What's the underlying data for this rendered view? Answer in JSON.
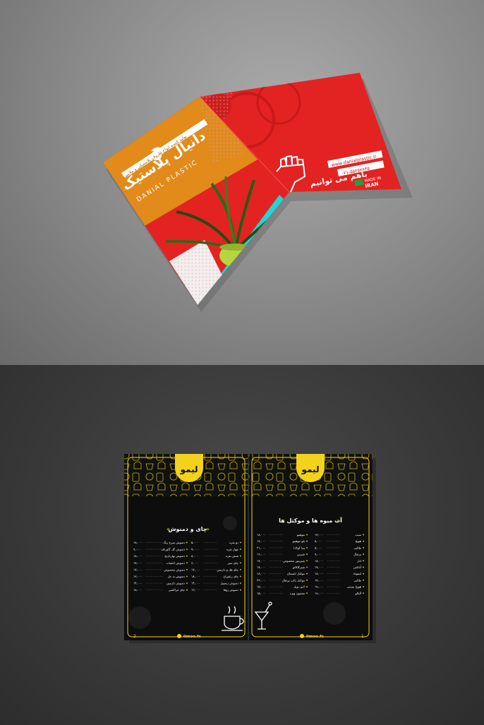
{
  "top_brochure": {
    "brand_name_fa": "دانیال پلاستیک",
    "brand_name_en": "DANIAL PLASTIC",
    "tagline_fa": "تولید کننده انواع ظروف پلاستیکی و ملامین",
    "slogan_fa": "باهم می توانیم",
    "contact_web": "www.danialplastic.ir",
    "contact_phone": "۰۲۱-۵۵۲۵۷۸۴۵",
    "made_in": "MADE IN",
    "country": "IRAN",
    "colors": {
      "orange": "#e28a1a",
      "red": "#e22424",
      "cyan": "#1fd6d6",
      "white": "#f2f2f2"
    }
  },
  "bottom_menu": {
    "logo": "لیمو",
    "left_page": {
      "section_title": "چای و دمنوش",
      "page_number": "2",
      "footer": "limoo.fc",
      "col_left_items": [
        {
          "name": "دمنوش سرخ رنگ",
          "price": "۱۸,۰۰۰"
        },
        {
          "name": "دمنوش گل گاوزبان",
          "price": "۹,۰۰۰"
        },
        {
          "name": "دمنوش بهارنارنج",
          "price": "۱۸,۰۰۰"
        },
        {
          "name": "دمنوش اعصاب",
          "price": "۱۷,۰۰۰"
        },
        {
          "name": "دمنوش مخصوص",
          "price": "۱۷,۰۰۰"
        },
        {
          "name": "دمنوش به حل",
          "price": "۱۳,۰۰۰"
        },
        {
          "name": "دمنوش دارچین",
          "price": "۱۴,۰۰۰"
        },
        {
          "name": "چای مراکشی",
          "price": "۱۸,۰۰۰"
        }
      ],
      "col_right_items": [
        {
          "name": "دو نفره",
          "price": "۵,۰۰۰"
        },
        {
          "name": "چهار نفره",
          "price": "۷,۰۰۰"
        },
        {
          "name": "شش نفره",
          "price": "۸,۰۰۰"
        },
        {
          "name": "چای سبز",
          "price": "۶,۰۰۰"
        },
        {
          "name": "چای هل و دارچین",
          "price": "۱۷,۰۰۰"
        },
        {
          "name": "چای زعفران",
          "price": "۱۸,۰۰۰"
        },
        {
          "name": "دمنوش زنجبیل",
          "price": "۱۴,۰۰۰"
        },
        {
          "name": "دمنوش زوفا",
          "price": "۱۳,۰۰۰"
        }
      ]
    },
    "right_page": {
      "section_title": "آب میوه ها و موکتل ها",
      "page_number": "1",
      "footer": "limoo.fc",
      "col_left_items": [
        {
          "name": "موهیتو",
          "price": "۱۸,۰۰۰"
        },
        {
          "name": "بلو موهیتو",
          "price": "۱۷,۰۰۰"
        },
        {
          "name": "پینا کولادا",
          "price": "۲۱,۰۰۰"
        },
        {
          "name": "شیرین",
          "price": "۱۹,۰۰۰"
        },
        {
          "name": "شیرموز مخصوص",
          "price": "۱۷,۰۰۰"
        },
        {
          "name": "شیرکاکائو",
          "price": "۱۷,۰۰۰"
        },
        {
          "name": "موکتل تابستان",
          "price": "۱۸,۰۰۰"
        },
        {
          "name": "موکتل پالپ پرتقال",
          "price": "۲۳,۰۰۰"
        },
        {
          "name": "لایم دوبل",
          "price": "۱۵,۰۰۰"
        },
        {
          "name": "معجون ویژه",
          "price": "۱۵,۰۰۰"
        }
      ],
      "col_right_items": [
        {
          "name": "سیب",
          "price": "۱۳,۰۰۰"
        },
        {
          "name": "هویج",
          "price": "۸,۰۰۰"
        },
        {
          "name": "طالبی",
          "price": "۸,۰۰۰"
        },
        {
          "name": "پرتقال",
          "price": "۹,۰۰۰"
        },
        {
          "name": "انار",
          "price": "۱۸,۰۰۰"
        },
        {
          "name": "آناناس",
          "price": "۱۷,۰۰۰"
        },
        {
          "name": "لیموناد",
          "price": "۱۸,۰۰۰"
        },
        {
          "name": "طالبی",
          "price": "۱۷,۰۰۰"
        },
        {
          "name": "هویج بستنی",
          "price": "۱۹,۰۰۰"
        },
        {
          "name": "آلبالو",
          "price": "۱۹,۰۰۰"
        }
      ]
    }
  }
}
